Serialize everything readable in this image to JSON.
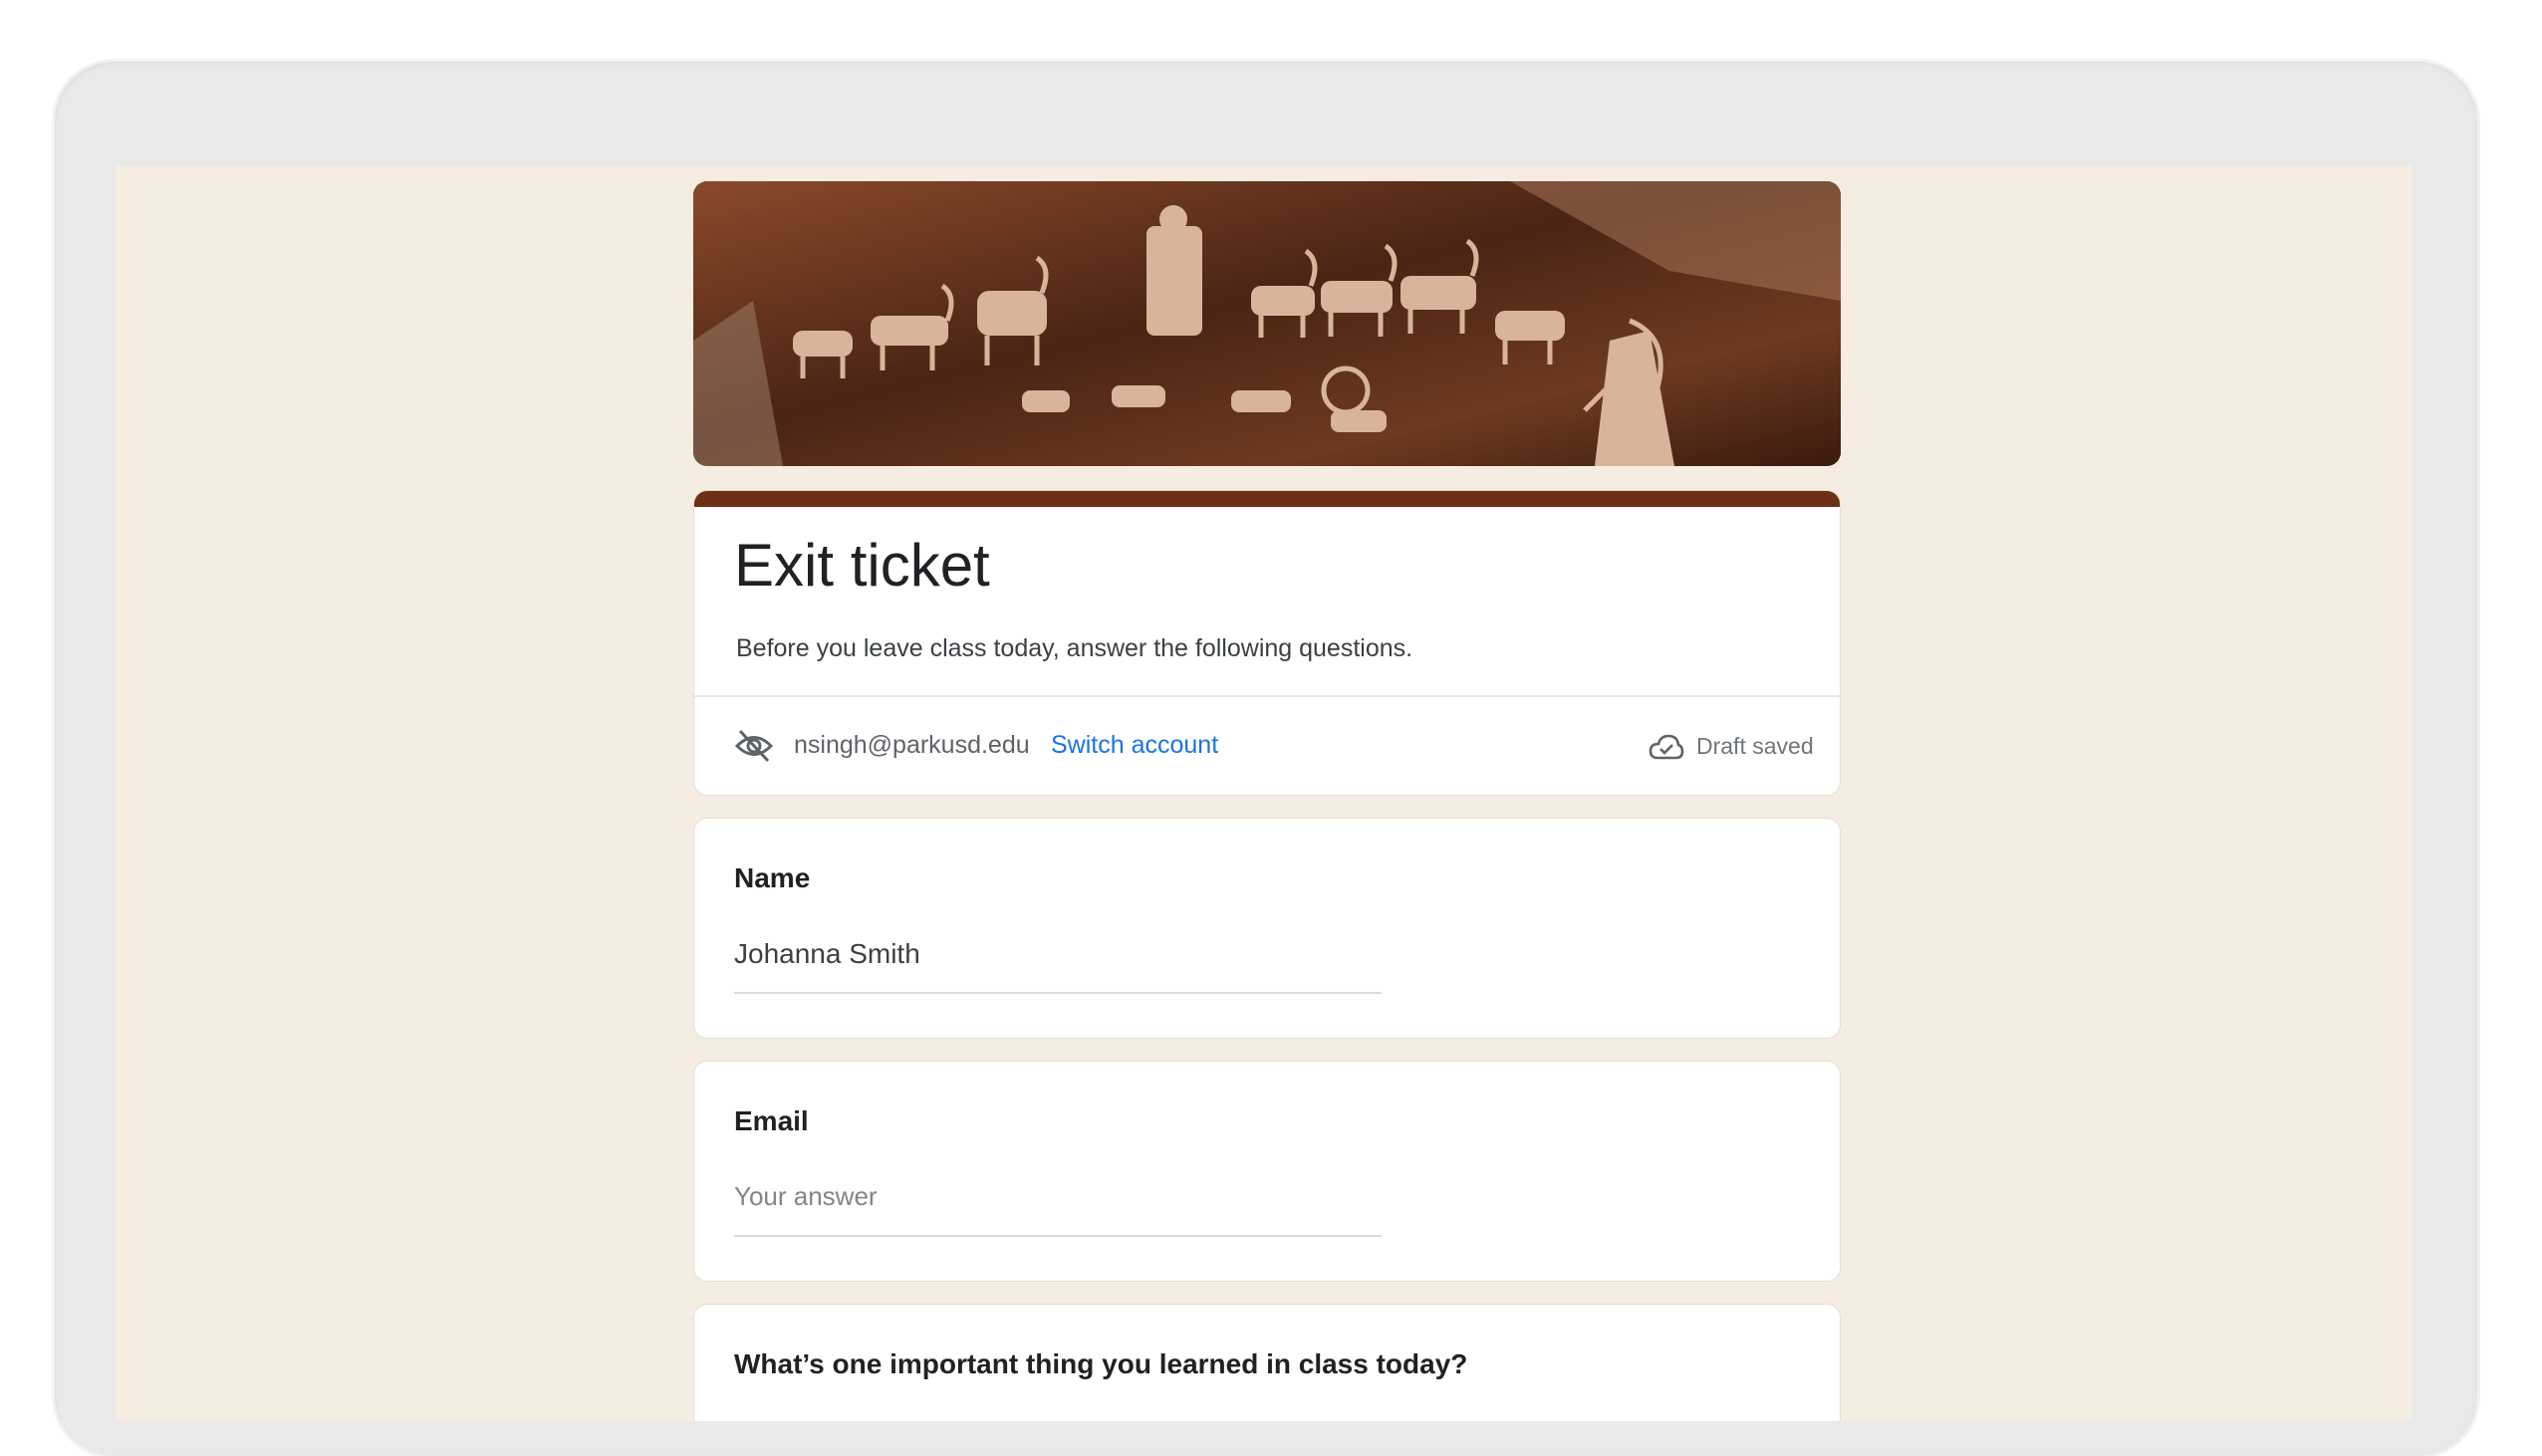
{
  "form": {
    "title": "Exit ticket",
    "description": "Before you leave class today, answer the following questions.",
    "account_email": "nsingh@parkusd.edu",
    "switch_account_label": "Switch account",
    "draft_status": "Draft saved"
  },
  "questions": [
    {
      "label": "Name",
      "answer": "Johanna Smith"
    },
    {
      "label": "Email",
      "placeholder": "Your answer"
    },
    {
      "label": "What’s one important thing you learned in class today?"
    }
  ],
  "colors": {
    "theme": "#6d2f16",
    "background": "#f5ece2",
    "link": "#1a73e8"
  },
  "icons": [
    "eye-off-icon",
    "cloud-done-icon"
  ]
}
